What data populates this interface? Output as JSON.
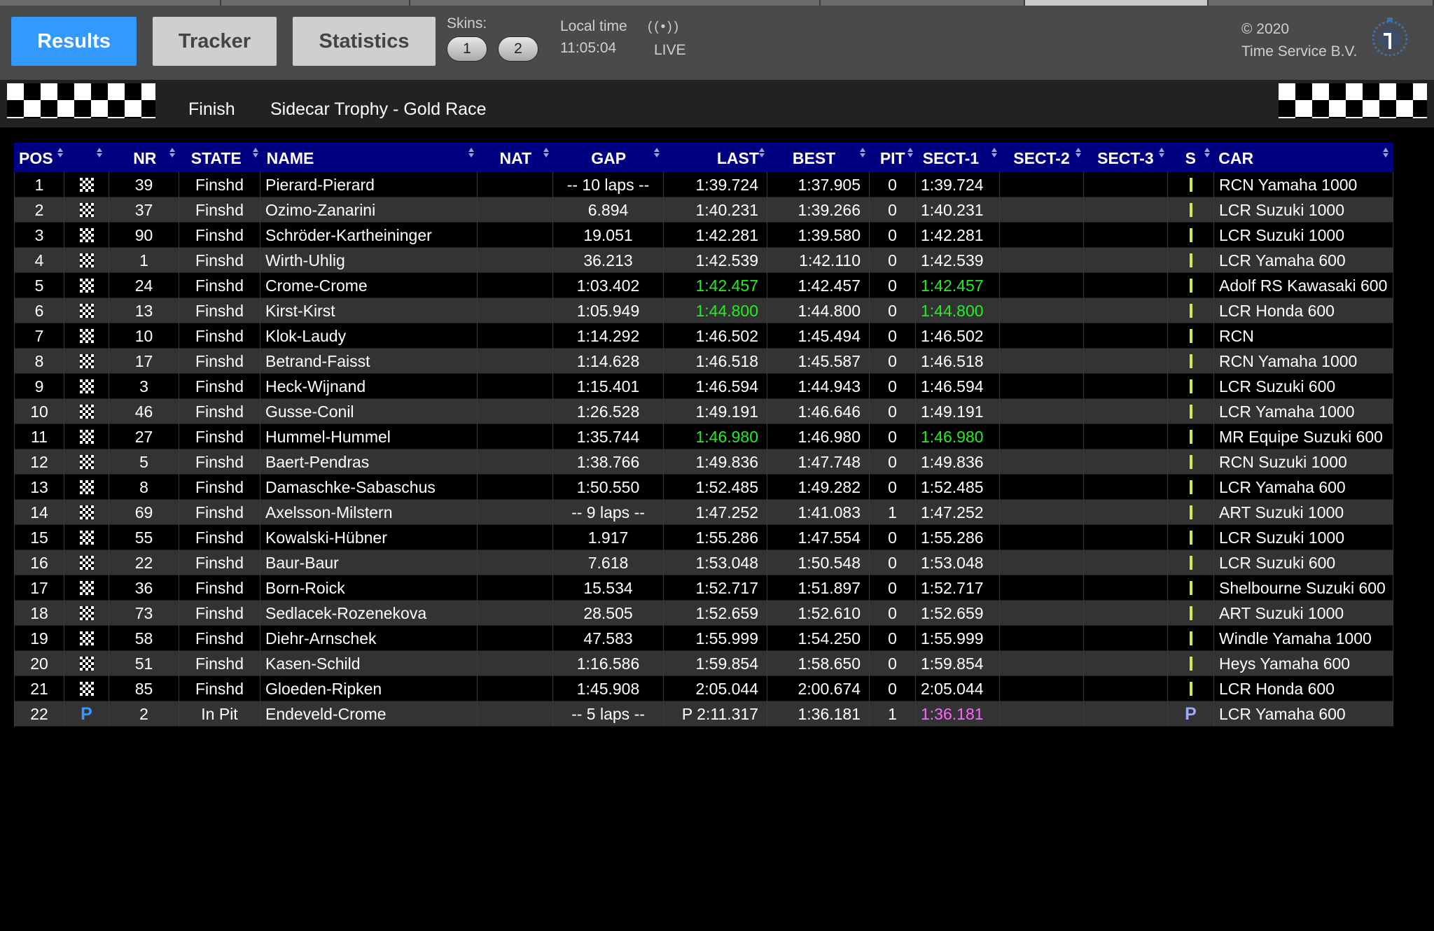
{
  "toolbar": {
    "results_label": "Results",
    "tracker_label": "Tracker",
    "statistics_label": "Statistics",
    "skins_label": "Skins:",
    "skins": [
      "1",
      "2"
    ],
    "local_time_label": "Local time",
    "local_time": "11:05:04",
    "live_icon": "((•))",
    "live_label": "LIVE",
    "copyright": "© 2020",
    "company": "Time Service B.V."
  },
  "banner": {
    "state": "Finish",
    "race_name": "Sidecar Trophy - Gold Race"
  },
  "colors": {
    "active_tab": "#3399ff",
    "header_bg": "#000080",
    "sector_best": "#22ee22",
    "overall_best": "#ff66ff",
    "status_bar": "#ccee44",
    "pit_indicator": "#3399ff"
  },
  "icons": {
    "finish_flag": "checkered-flag-icon",
    "pit": "pit-icon",
    "sort": "sort-icon",
    "live": "live-broadcast-icon",
    "logo": "stopwatch-logo-icon"
  },
  "table": {
    "columns": [
      "POS",
      "",
      "NR",
      "STATE",
      "NAME",
      "NAT",
      "GAP",
      "LAST",
      "BEST",
      "PIT",
      "SECT-1",
      "SECT-2",
      "SECT-3",
      "S",
      "CAR"
    ],
    "rows": [
      {
        "pos": "1",
        "flag": "checkered",
        "nr": "39",
        "state": "Finshd",
        "name": "Pierard-Pierard",
        "nat": "",
        "gap": "-- 10 laps --",
        "last": "1:39.724",
        "last_hl": "",
        "best": "1:37.905",
        "pit": "0",
        "s1": "1:39.724",
        "s1_hl": "",
        "s2": "",
        "s3": "",
        "s": "bar",
        "car": "RCN Yamaha 1000"
      },
      {
        "pos": "2",
        "flag": "checkered",
        "nr": "37",
        "state": "Finshd",
        "name": "Ozimo-Zanarini",
        "nat": "",
        "gap": "6.894",
        "last": "1:40.231",
        "last_hl": "",
        "best": "1:39.266",
        "pit": "0",
        "s1": "1:40.231",
        "s1_hl": "",
        "s2": "",
        "s3": "",
        "s": "bar",
        "car": "LCR Suzuki 1000"
      },
      {
        "pos": "3",
        "flag": "checkered",
        "nr": "90",
        "state": "Finshd",
        "name": "Schröder-Kartheininger",
        "nat": "",
        "gap": "19.051",
        "last": "1:42.281",
        "last_hl": "",
        "best": "1:39.580",
        "pit": "0",
        "s1": "1:42.281",
        "s1_hl": "",
        "s2": "",
        "s3": "",
        "s": "bar",
        "car": "LCR Suzuki 1000"
      },
      {
        "pos": "4",
        "flag": "checkered",
        "nr": "1",
        "state": "Finshd",
        "name": "Wirth-Uhlig",
        "nat": "",
        "gap": "36.213",
        "last": "1:42.539",
        "last_hl": "",
        "best": "1:42.110",
        "pit": "0",
        "s1": "1:42.539",
        "s1_hl": "",
        "s2": "",
        "s3": "",
        "s": "bar",
        "car": "LCR Yamaha 600"
      },
      {
        "pos": "5",
        "flag": "checkered",
        "nr": "24",
        "state": "Finshd",
        "name": "Crome-Crome",
        "nat": "",
        "gap": "1:03.402",
        "last": "1:42.457",
        "last_hl": "green",
        "best": "1:42.457",
        "pit": "0",
        "s1": "1:42.457",
        "s1_hl": "green",
        "s2": "",
        "s3": "",
        "s": "bar",
        "car": "Adolf RS Kawasaki 600"
      },
      {
        "pos": "6",
        "flag": "checkered",
        "nr": "13",
        "state": "Finshd",
        "name": "Kirst-Kirst",
        "nat": "",
        "gap": "1:05.949",
        "last": "1:44.800",
        "last_hl": "green",
        "best": "1:44.800",
        "pit": "0",
        "s1": "1:44.800",
        "s1_hl": "green",
        "s2": "",
        "s3": "",
        "s": "bar",
        "car": "LCR Honda 600"
      },
      {
        "pos": "7",
        "flag": "checkered",
        "nr": "10",
        "state": "Finshd",
        "name": "Klok-Laudy",
        "nat": "",
        "gap": "1:14.292",
        "last": "1:46.502",
        "last_hl": "",
        "best": "1:45.494",
        "pit": "0",
        "s1": "1:46.502",
        "s1_hl": "",
        "s2": "",
        "s3": "",
        "s": "bar",
        "car": "RCN"
      },
      {
        "pos": "8",
        "flag": "checkered",
        "nr": "17",
        "state": "Finshd",
        "name": "Betrand-Faisst",
        "nat": "",
        "gap": "1:14.628",
        "last": "1:46.518",
        "last_hl": "",
        "best": "1:45.587",
        "pit": "0",
        "s1": "1:46.518",
        "s1_hl": "",
        "s2": "",
        "s3": "",
        "s": "bar",
        "car": "RCN Yamaha 1000"
      },
      {
        "pos": "9",
        "flag": "checkered",
        "nr": "3",
        "state": "Finshd",
        "name": "Heck-Wijnand",
        "nat": "",
        "gap": "1:15.401",
        "last": "1:46.594",
        "last_hl": "",
        "best": "1:44.943",
        "pit": "0",
        "s1": "1:46.594",
        "s1_hl": "",
        "s2": "",
        "s3": "",
        "s": "bar",
        "car": "LCR Suzuki 600"
      },
      {
        "pos": "10",
        "flag": "checkered",
        "nr": "46",
        "state": "Finshd",
        "name": "Gusse-Conil",
        "nat": "",
        "gap": "1:26.528",
        "last": "1:49.191",
        "last_hl": "",
        "best": "1:46.646",
        "pit": "0",
        "s1": "1:49.191",
        "s1_hl": "",
        "s2": "",
        "s3": "",
        "s": "bar",
        "car": "LCR Yamaha 1000"
      },
      {
        "pos": "11",
        "flag": "checkered",
        "nr": "27",
        "state": "Finshd",
        "name": "Hummel-Hummel",
        "nat": "",
        "gap": "1:35.744",
        "last": "1:46.980",
        "last_hl": "green",
        "best": "1:46.980",
        "pit": "0",
        "s1": "1:46.980",
        "s1_hl": "green",
        "s2": "",
        "s3": "",
        "s": "bar",
        "car": "MR Equipe Suzuki 600"
      },
      {
        "pos": "12",
        "flag": "checkered",
        "nr": "5",
        "state": "Finshd",
        "name": "Baert-Pendras",
        "nat": "",
        "gap": "1:38.766",
        "last": "1:49.836",
        "last_hl": "",
        "best": "1:47.748",
        "pit": "0",
        "s1": "1:49.836",
        "s1_hl": "",
        "s2": "",
        "s3": "",
        "s": "bar",
        "car": "RCN Suzuki 1000"
      },
      {
        "pos": "13",
        "flag": "checkered",
        "nr": "8",
        "state": "Finshd",
        "name": "Damaschke-Sabaschus",
        "nat": "",
        "gap": "1:50.550",
        "last": "1:52.485",
        "last_hl": "",
        "best": "1:49.282",
        "pit": "0",
        "s1": "1:52.485",
        "s1_hl": "",
        "s2": "",
        "s3": "",
        "s": "bar",
        "car": "LCR Yamaha 600"
      },
      {
        "pos": "14",
        "flag": "checkered",
        "nr": "69",
        "state": "Finshd",
        "name": "Axelsson-Milstern",
        "nat": "",
        "gap": "-- 9 laps --",
        "last": "1:47.252",
        "last_hl": "",
        "best": "1:41.083",
        "pit": "1",
        "s1": "1:47.252",
        "s1_hl": "",
        "s2": "",
        "s3": "",
        "s": "bar",
        "car": "ART Suzuki 1000"
      },
      {
        "pos": "15",
        "flag": "checkered",
        "nr": "55",
        "state": "Finshd",
        "name": "Kowalski-Hübner",
        "nat": "",
        "gap": "1.917",
        "last": "1:55.286",
        "last_hl": "",
        "best": "1:47.554",
        "pit": "0",
        "s1": "1:55.286",
        "s1_hl": "",
        "s2": "",
        "s3": "",
        "s": "bar",
        "car": "LCR Suzuki 1000"
      },
      {
        "pos": "16",
        "flag": "checkered",
        "nr": "22",
        "state": "Finshd",
        "name": "Baur-Baur",
        "nat": "",
        "gap": "7.618",
        "last": "1:53.048",
        "last_hl": "",
        "best": "1:50.548",
        "pit": "0",
        "s1": "1:53.048",
        "s1_hl": "",
        "s2": "",
        "s3": "",
        "s": "bar",
        "car": "LCR Suzuki 600"
      },
      {
        "pos": "17",
        "flag": "checkered",
        "nr": "36",
        "state": "Finshd",
        "name": "Born-Roick",
        "nat": "",
        "gap": "15.534",
        "last": "1:52.717",
        "last_hl": "",
        "best": "1:51.897",
        "pit": "0",
        "s1": "1:52.717",
        "s1_hl": "",
        "s2": "",
        "s3": "",
        "s": "bar",
        "car": "Shelbourne Suzuki 600"
      },
      {
        "pos": "18",
        "flag": "checkered",
        "nr": "73",
        "state": "Finshd",
        "name": "Sedlacek-Rozenekova",
        "nat": "",
        "gap": "28.505",
        "last": "1:52.659",
        "last_hl": "",
        "best": "1:52.610",
        "pit": "0",
        "s1": "1:52.659",
        "s1_hl": "",
        "s2": "",
        "s3": "",
        "s": "bar",
        "car": "ART Suzuki 1000"
      },
      {
        "pos": "19",
        "flag": "checkered",
        "nr": "58",
        "state": "Finshd",
        "name": "Diehr-Arnschek",
        "nat": "",
        "gap": "47.583",
        "last": "1:55.999",
        "last_hl": "",
        "best": "1:54.250",
        "pit": "0",
        "s1": "1:55.999",
        "s1_hl": "",
        "s2": "",
        "s3": "",
        "s": "bar",
        "car": "Windle Yamaha 1000"
      },
      {
        "pos": "20",
        "flag": "checkered",
        "nr": "51",
        "state": "Finshd",
        "name": "Kasen-Schild",
        "nat": "",
        "gap": "1:16.586",
        "last": "1:59.854",
        "last_hl": "",
        "best": "1:58.650",
        "pit": "0",
        "s1": "1:59.854",
        "s1_hl": "",
        "s2": "",
        "s3": "",
        "s": "bar",
        "car": "Heys Yamaha 600"
      },
      {
        "pos": "21",
        "flag": "checkered",
        "nr": "85",
        "state": "Finshd",
        "name": "Gloeden-Ripken",
        "nat": "",
        "gap": "1:45.908",
        "last": "2:05.044",
        "last_hl": "",
        "best": "2:00.674",
        "pit": "0",
        "s1": "2:05.044",
        "s1_hl": "",
        "s2": "",
        "s3": "",
        "s": "bar",
        "car": "LCR Honda 600"
      },
      {
        "pos": "22",
        "flag": "pit",
        "nr": "2",
        "state": "In Pit",
        "name": "Endeveld-Crome",
        "nat": "",
        "gap": "-- 5 laps --",
        "last": "P 2:11.317",
        "last_hl": "",
        "best": "1:36.181",
        "pit": "1",
        "s1": "1:36.181",
        "s1_hl": "magenta",
        "s2": "",
        "s3": "",
        "s": "P",
        "car": "LCR Yamaha 600"
      }
    ]
  }
}
